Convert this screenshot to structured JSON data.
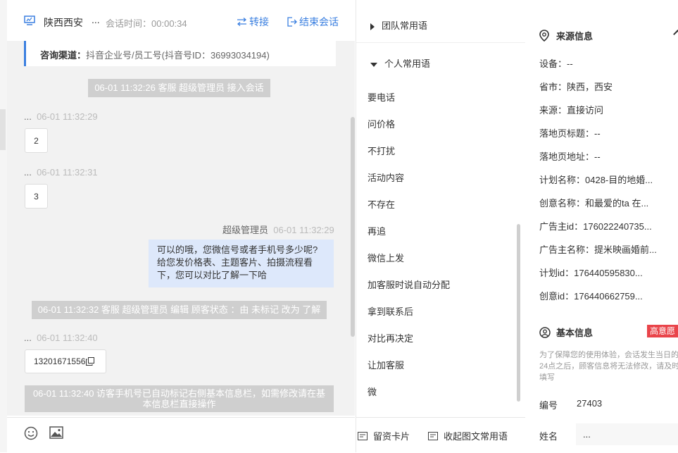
{
  "chat_header": {
    "visitor_name": "陕西西安",
    "name_ellipsis": "...",
    "session_time_label": "会话时间：",
    "session_time": "00:00:34",
    "transfer_label": "转接",
    "end_label": "结束会话"
  },
  "channel": {
    "label": "咨询渠道：",
    "value": "抖音企业号/员工号(抖音号ID：36993034194)"
  },
  "messages": {
    "sys1": "06-01 11:32:26 客服 超级管理员 接入会话",
    "m1_sender": "...",
    "m1_time": "06-01 11:32:29",
    "m1_text": "2",
    "m2_sender": "...",
    "m2_time": "06-01 11:32:31",
    "m2_text": "3",
    "m3_sender": "超级管理员",
    "m3_time": "06-01 11:32:29",
    "m3_line1": "可以的哦，您微信号或者手机号多少呢?",
    "m3_line2": "给您发价格表、主题客片、拍摄流程看",
    "m3_line3": "下，您可以对比了解一下哈",
    "sys2": "06-01 11:32:32 客服 超级管理员 编辑 顾客状态 ：由 未标记 改为 了解",
    "m4_sender": "...",
    "m4_time": "06-01 11:32:40",
    "m4_text": "13201671556",
    "sys3_line1": "06-01 11:32:40 访客手机号已自动标记右侧基本信息栏，如需修改请在基",
    "sys3_line2": "本信息栏直接操作"
  },
  "phrases": {
    "team_group": "团队常用语",
    "personal_group": "个人常用语",
    "items": [
      "要电话",
      "问价格",
      "不打扰",
      "活动内容",
      "不存在",
      "再追",
      "微信上发",
      "加客服时说自动分配",
      "拿到联系后",
      "对比再决定",
      "让加客服",
      "微"
    ]
  },
  "mid_toolbar": {
    "card_label": "留资卡片",
    "collapse_label": "收起图文常用语"
  },
  "source_info": {
    "title": "来源信息",
    "device": "设备：--",
    "province": "省市：陕西，西安",
    "source": "来源：直接访问",
    "landing_title": "落地页标题：--",
    "landing_url": "落地页地址：--",
    "plan_name": "计划名称：0428-目的地婚...",
    "creative_name": "创意名称：和最爱的ta 在...",
    "advertiser_id": "广告主id：176022240735...",
    "advertiser_name": "广告主名称：提米映画婚前...",
    "plan_id": "计划id：176440595830...",
    "creative_id": "创意id：176440662759..."
  },
  "basic_info": {
    "title": "基本信息",
    "intent_badge": "高意愿",
    "notice": "为了保障您的使用体验，会话发生当日的24点之后，顾客信息将无法修改，请及时填写",
    "id_label": "编号",
    "id_value": "27403",
    "name_label": "姓名",
    "name_value": "..."
  },
  "colors": {
    "accent": "#3a7fe0",
    "system_message": "#cfcfcf",
    "agent_bubble": "#dde8fb",
    "intent_badge": "#e9444a"
  }
}
